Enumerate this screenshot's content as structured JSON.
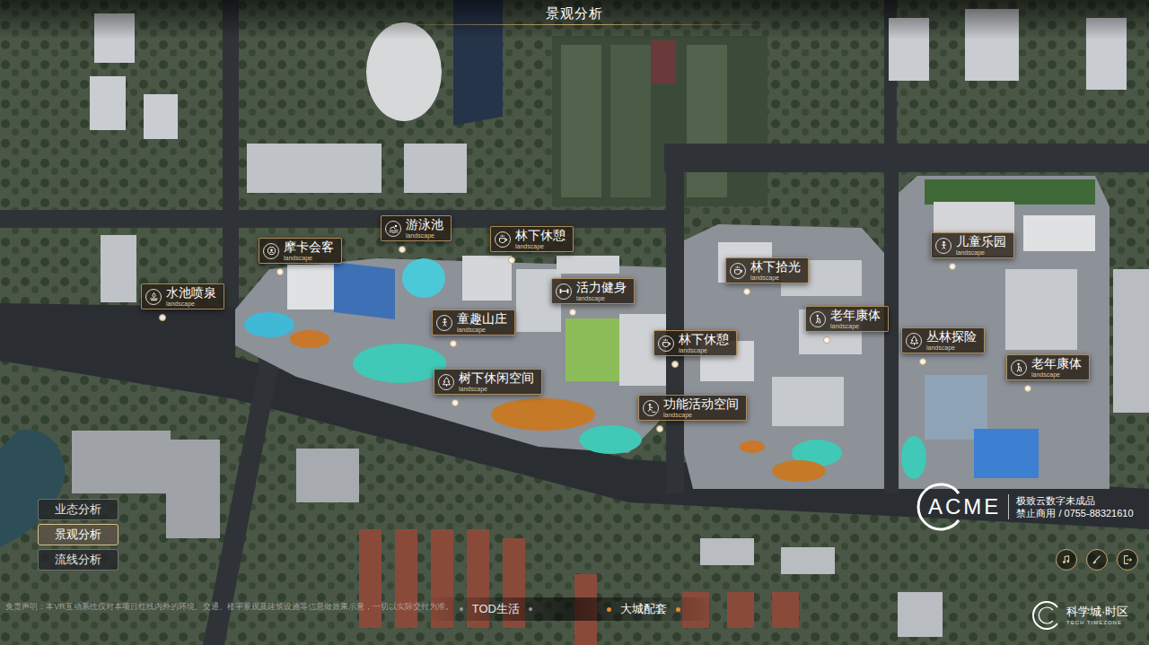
{
  "header": {
    "title": "景观分析"
  },
  "pins": [
    {
      "label": "水池喷泉",
      "sub": "landscape",
      "kind": "fountain"
    },
    {
      "label": "摩卡会客",
      "sub": "landscape",
      "kind": "meeting"
    },
    {
      "label": "游泳池",
      "sub": "landscape",
      "kind": "swim"
    },
    {
      "label": "林下休憩",
      "sub": "landscape",
      "kind": "cafe"
    },
    {
      "label": "活力健身",
      "sub": "landscape",
      "kind": "fitness"
    },
    {
      "label": "童趣山庄",
      "sub": "landscape",
      "kind": "kids"
    },
    {
      "label": "树下休闲空间",
      "sub": "landscape",
      "kind": "tree"
    },
    {
      "label": "功能活动空间",
      "sub": "landscape",
      "kind": "activity"
    },
    {
      "label": "林下拾光",
      "sub": "landscape",
      "kind": "cafe"
    },
    {
      "label": "老年康体",
      "sub": "landscape",
      "kind": "elderly"
    },
    {
      "label": "林下休憩",
      "sub": "landscape",
      "kind": "cafe"
    },
    {
      "label": "儿童乐园",
      "sub": "landscape",
      "kind": "kids"
    },
    {
      "label": "丛林探险",
      "sub": "landscape",
      "kind": "tree"
    },
    {
      "label": "老年康体",
      "sub": "landscape",
      "kind": "elderly"
    }
  ],
  "side_menu": [
    {
      "label": "业态分析",
      "selected": false
    },
    {
      "label": "景观分析",
      "selected": true
    },
    {
      "label": "流线分析",
      "selected": false
    }
  ],
  "bottom_tabs": [
    {
      "label": "TOD生活",
      "selected": false
    },
    {
      "label": "大城配套",
      "selected": true
    }
  ],
  "watermark": {
    "brand": "ACME",
    "line1": "极致云数字未成品",
    "line2": "禁止商用 / 0755-88321610"
  },
  "disclaimer": "免责声明：本VR互动系统仅对本项目红线内外的环境、交通、楼宇景观及建筑设施等信息做效果示意，一切以实际交付为准。",
  "logo": {
    "name": "科学城·时区",
    "sub": "TECH TIMEZONE"
  },
  "tools": [
    {
      "kind": "music"
    },
    {
      "kind": "brush"
    },
    {
      "kind": "exit"
    }
  ]
}
